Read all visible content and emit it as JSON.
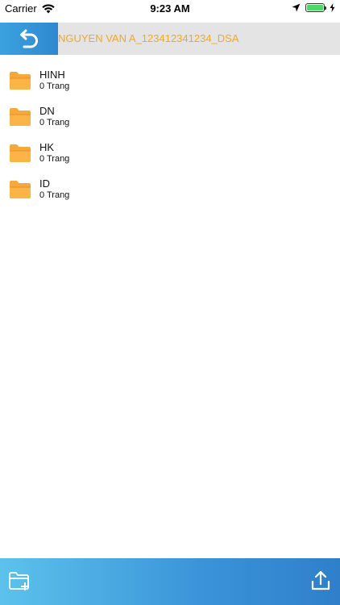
{
  "status_bar": {
    "carrier": "Carrier",
    "time": "9:23 AM",
    "battery_level": 1.0,
    "battery_color": "#4cd964"
  },
  "header": {
    "title": "NGUYEN VAN A_123412341234_DSA",
    "title_color": "#f5a623",
    "back_icon": "undo-arrow-icon"
  },
  "folders": [
    {
      "name": "HINH",
      "count": "0 Trang"
    },
    {
      "name": "DN",
      "count": "0 Trang"
    },
    {
      "name": "HK",
      "count": "0 Trang"
    },
    {
      "name": "ID",
      "count": "0 Trang"
    }
  ],
  "folder_icon": "folder-icon",
  "folder_color": "#f7a83a",
  "bottom_bar": {
    "left_icon": "new-folder-icon",
    "right_icon": "upload-icon"
  }
}
